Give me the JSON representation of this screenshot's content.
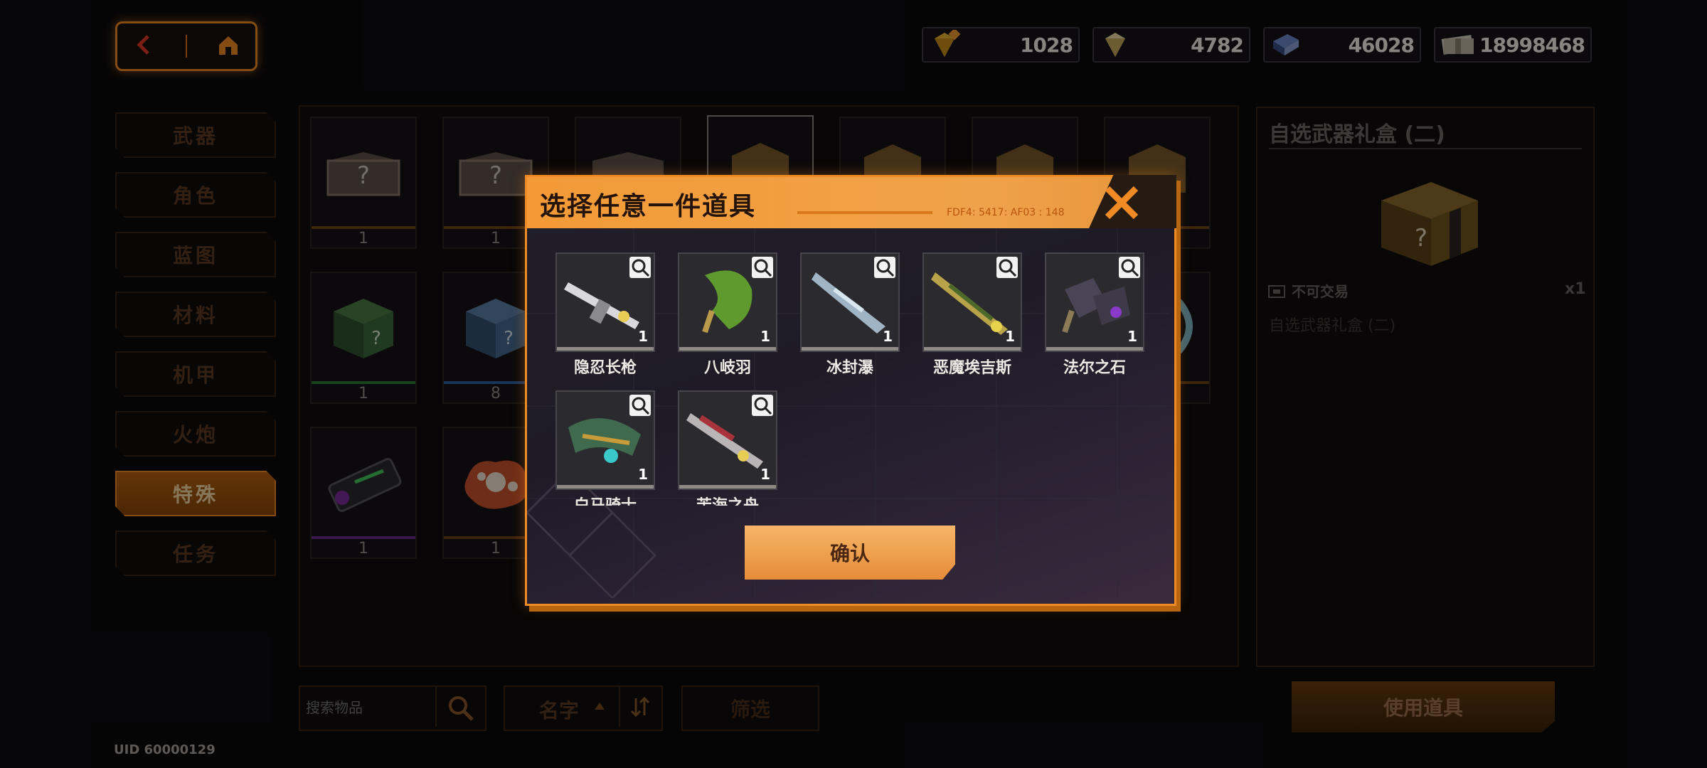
{
  "topbar": {
    "currencies": [
      {
        "icon": "gold-diamond-icon",
        "value": "1028"
      },
      {
        "icon": "silver-diamond-icon",
        "value": "4782"
      },
      {
        "icon": "blue-crystal-icon",
        "value": "46028"
      },
      {
        "icon": "cash-bundle-icon",
        "value": "18998468"
      }
    ]
  },
  "sidebar": {
    "items": [
      {
        "label": "武器"
      },
      {
        "label": "角色"
      },
      {
        "label": "蓝图"
      },
      {
        "label": "材料"
      },
      {
        "label": "机甲"
      },
      {
        "label": "火炮"
      },
      {
        "label": "特殊",
        "active": true
      },
      {
        "label": "任务"
      }
    ]
  },
  "grid": {
    "slots": [
      {
        "count": "1",
        "art": "folder"
      },
      {
        "count": "1",
        "art": "folder"
      },
      {
        "count": "",
        "art": "folder"
      },
      {
        "count": "",
        "art": "box"
      },
      {
        "count": "",
        "art": "box"
      },
      {
        "count": "",
        "art": "box"
      },
      {
        "count": "",
        "art": "box"
      },
      {
        "count": "1",
        "art": "green-box"
      },
      {
        "count": "8",
        "art": "blue-box"
      },
      {
        "count": "1",
        "art": "capsule"
      },
      {
        "count": "1",
        "art": "blob"
      }
    ]
  },
  "detail": {
    "title": "自选武器礼盒 (二)",
    "trade_label": "不可交易",
    "quantity": "x1",
    "description": "自选武器礼盒 (二)"
  },
  "bottombar": {
    "search_placeholder": "搜索物品",
    "sort_label": "名字",
    "filter_label": "筛选",
    "use_label": "使用道具"
  },
  "uid": "UID 60000129",
  "modal": {
    "title": "选择任意一件道具",
    "code": "FDF4: 5417: AF03 : 148",
    "confirm_label": "确认",
    "items": [
      {
        "name": "隐忍长枪",
        "qty": "1"
      },
      {
        "name": "八岐羽",
        "qty": "1"
      },
      {
        "name": "冰封瀑",
        "qty": "1"
      },
      {
        "name": "恶魔埃吉斯",
        "qty": "1"
      },
      {
        "name": "法尔之石",
        "qty": "1"
      },
      {
        "name": "白马骑士",
        "qty": "1"
      },
      {
        "name": "苦海之舟",
        "qty": "1"
      }
    ]
  },
  "colors": {
    "accent": "#f08a24",
    "modal_header": "#f39a36",
    "confirm": "#f0a04e"
  }
}
